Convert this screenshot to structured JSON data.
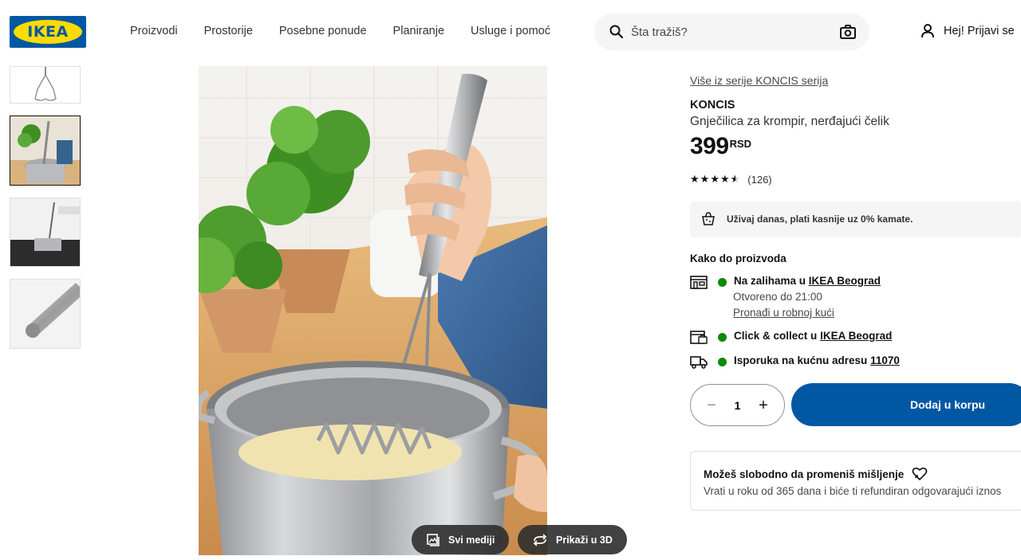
{
  "header": {
    "logo_text": "IKEA",
    "nav": [
      "Proizvodi",
      "Prostorije",
      "Posebne ponude",
      "Planiranje",
      "Usluge i pomoć"
    ],
    "search_placeholder": "Šta tražiš?",
    "search_icon": "search-icon",
    "camera_icon": "camera-icon",
    "login_label": "Hej! Prijavi se",
    "login_icon": "person-icon"
  },
  "gallery": {
    "thumbnail_count": 4,
    "selected_index": 1,
    "media_buttons": {
      "all_media": "Svi mediji",
      "view_3d": "Prikaži u 3D"
    }
  },
  "product": {
    "series_link": "Više iz serije KONCIS serija",
    "name": "KONCIS",
    "description": "Gnječilica za krompir, nerđajući čelik",
    "price": "399",
    "currency": "RSD",
    "rating_value": 4.5,
    "rating_count": "(126)",
    "banner_text": "Uživaj danas, plati kasnije uz 0% kamate."
  },
  "availability": {
    "title": "Kako do proizvoda",
    "stock_prefix": "Na zalihama u",
    "stock_store": "IKEA Beograd",
    "open_until": "Otvoreno do 21:00",
    "find_in_store": "Pronađi u robnoj kući",
    "click_collect_prefix": "Click & collect u",
    "click_collect_store": "IKEA Beograd",
    "delivery_prefix": "Isporuka na kućnu adresu",
    "delivery_zip": "11070",
    "status_color": "#0a8a00"
  },
  "cart": {
    "quantity": "1",
    "add_label": "Dodaj u korpu",
    "accent": "#0058a3"
  },
  "returns": {
    "title": "Možeš slobodno da promeniš mišljenje",
    "text": "Vrati u roku od 365 dana i biće ti refundiran odgovarajući iznos"
  }
}
